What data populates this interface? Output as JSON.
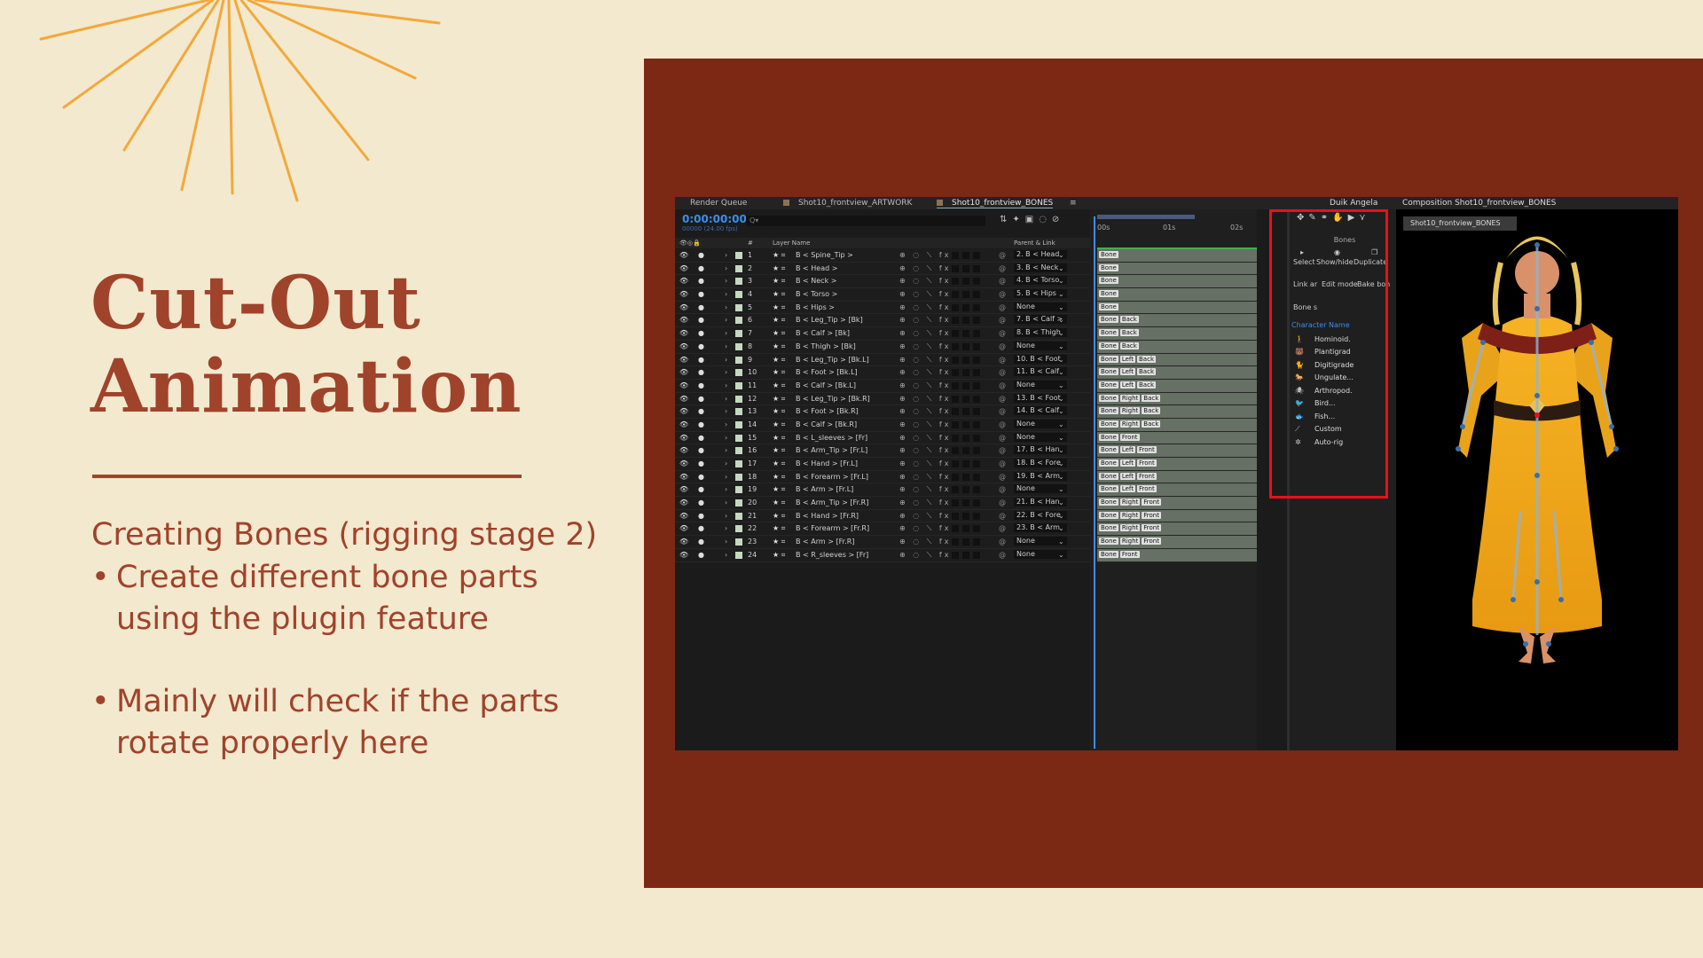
{
  "slide": {
    "title_line1": "Cut-Out",
    "title_line2": "Animation",
    "subheading": "Creating Bones (rigging stage 2)",
    "bullets": [
      "Create different bone parts using the plugin feature",
      "Mainly will check if the parts rotate properly here"
    ],
    "bullet_glyph": "•"
  },
  "colors": {
    "background": "#f2e9cf",
    "accent": "#a0432b",
    "panel": "#7b2815",
    "sunburst": "#f2a93b",
    "highlight": "#e8101c"
  },
  "ae": {
    "tabs": [
      "Render Queue",
      "Shot10_frontview_ARTWORK",
      "Shot10_frontview_BONES"
    ],
    "timecode": "0:00:00:00",
    "fps": "00000 (24.00 fps)",
    "search_placeholder": "Q▾",
    "col_layer_name": "Layer Name",
    "col_parent": "Parent & Link",
    "col_num": "#",
    "ruler": [
      "00s",
      "01s",
      "02s"
    ],
    "layers": [
      {
        "n": "1",
        "name": "B < Spine_Tip >",
        "parent": "2. B < Head",
        "tags": [
          "Bone"
        ]
      },
      {
        "n": "2",
        "name": "B < Head >",
        "parent": "3. B < Neck",
        "tags": [
          "Bone"
        ]
      },
      {
        "n": "3",
        "name": "B < Neck >",
        "parent": "4. B < Torso",
        "tags": [
          "Bone"
        ]
      },
      {
        "n": "4",
        "name": "B < Torso >",
        "parent": "5. B < Hips",
        "tags": [
          "Bone"
        ]
      },
      {
        "n": "5",
        "name": "B < Hips >",
        "parent": "None",
        "tags": [
          "Bone"
        ]
      },
      {
        "n": "6",
        "name": "B < Leg_Tip > [Bk]",
        "parent": "7. B < Calf >",
        "tags": [
          "Bone",
          "Back"
        ]
      },
      {
        "n": "7",
        "name": "B < Calf > [Bk]",
        "parent": "8. B < Thigh",
        "tags": [
          "Bone",
          "Back"
        ]
      },
      {
        "n": "8",
        "name": "B < Thigh > [Bk]",
        "parent": "None",
        "tags": [
          "Bone",
          "Back"
        ]
      },
      {
        "n": "9",
        "name": "B < Leg_Tip > [Bk.L]",
        "parent": "10. B < Foot",
        "tags": [
          "Bone",
          "Left",
          "Back"
        ]
      },
      {
        "n": "10",
        "name": "B < Foot > [Bk.L]",
        "parent": "11. B < Calf",
        "tags": [
          "Bone",
          "Left",
          "Back"
        ]
      },
      {
        "n": "11",
        "name": "B < Calf > [Bk.L]",
        "parent": "None",
        "tags": [
          "Bone",
          "Left",
          "Back"
        ]
      },
      {
        "n": "12",
        "name": "B < Leg_Tip > [Bk.R]",
        "parent": "13. B < Foot",
        "tags": [
          "Bone",
          "Right",
          "Back"
        ]
      },
      {
        "n": "13",
        "name": "B < Foot > [Bk.R]",
        "parent": "14. B < Calf",
        "tags": [
          "Bone",
          "Right",
          "Back"
        ]
      },
      {
        "n": "14",
        "name": "B < Calf > [Bk.R]",
        "parent": "None",
        "tags": [
          "Bone",
          "Right",
          "Back"
        ]
      },
      {
        "n": "15",
        "name": "B < L_sleeves > [Fr]",
        "parent": "None",
        "tags": [
          "Bone",
          "Front"
        ]
      },
      {
        "n": "16",
        "name": "B < Arm_Tip > [Fr.L]",
        "parent": "17. B < Han",
        "tags": [
          "Bone",
          "Left",
          "Front"
        ]
      },
      {
        "n": "17",
        "name": "B < Hand > [Fr.L]",
        "parent": "18. B < Fore",
        "tags": [
          "Bone",
          "Left",
          "Front"
        ]
      },
      {
        "n": "18",
        "name": "B < Forearm > [Fr.L]",
        "parent": "19. B < Arm",
        "tags": [
          "Bone",
          "Left",
          "Front"
        ]
      },
      {
        "n": "19",
        "name": "B < Arm > [Fr.L]",
        "parent": "None",
        "tags": [
          "Bone",
          "Left",
          "Front"
        ]
      },
      {
        "n": "20",
        "name": "B < Arm_Tip > [Fr.R]",
        "parent": "21. B < Han",
        "tags": [
          "Bone",
          "Right",
          "Front"
        ]
      },
      {
        "n": "21",
        "name": "B < Hand > [Fr.R]",
        "parent": "22. B < Fore",
        "tags": [
          "Bone",
          "Right",
          "Front"
        ]
      },
      {
        "n": "22",
        "name": "B < Forearm > [Fr.R]",
        "parent": "23. B < Arm",
        "tags": [
          "Bone",
          "Right",
          "Front"
        ]
      },
      {
        "n": "23",
        "name": "B < Arm > [Fr.R]",
        "parent": "None",
        "tags": [
          "Bone",
          "Right",
          "Front"
        ]
      },
      {
        "n": "24",
        "name": "B < R_sleeves > [Fr]",
        "parent": "None",
        "tags": [
          "Bone",
          "Front"
        ]
      }
    ]
  },
  "duik": {
    "title": "Duik Angela",
    "section": "Bones",
    "buttons_row1": [
      "Select",
      "Show/hide",
      "Duplicate"
    ],
    "buttons_row2": [
      "Link ar",
      "Edit mode",
      "Bake bon"
    ],
    "button_row3": "Bone s",
    "character_label": "Character Name",
    "types": [
      "Hominoid.",
      "Plantigrad",
      "Digitigrade",
      "Ungulate...",
      "Arthropod.",
      "Bird...",
      "Fish...",
      "Custom",
      "Auto-rig"
    ]
  },
  "composition": {
    "title": "Composition Shot10_frontview_BONES",
    "tab": "Shot10_frontview_BONES"
  }
}
